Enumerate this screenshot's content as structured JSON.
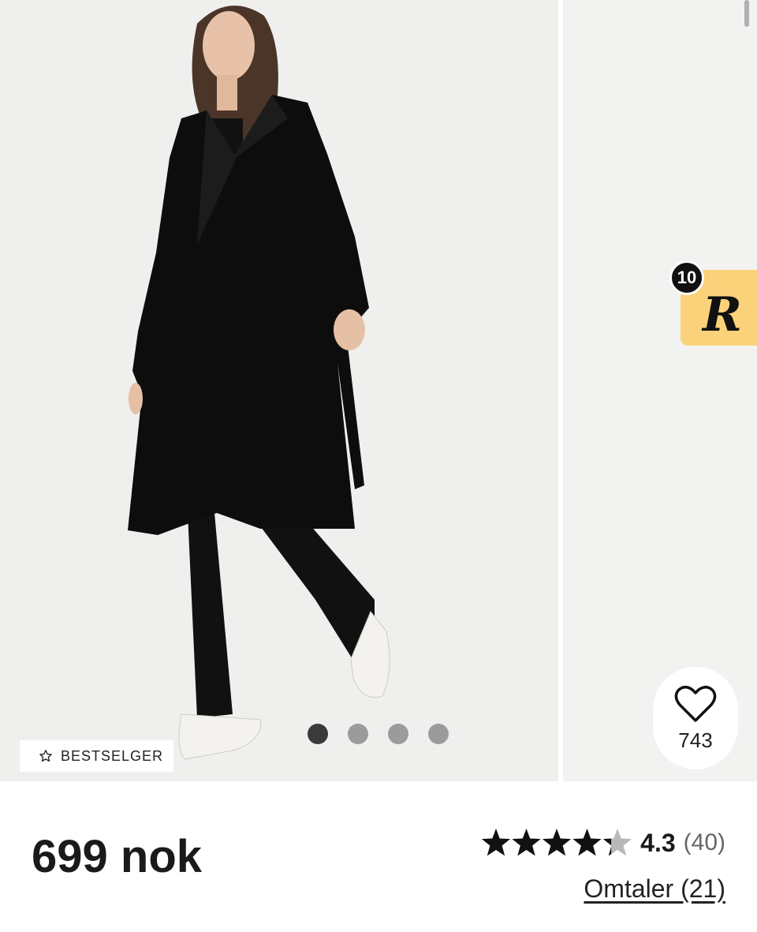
{
  "product": {
    "badge_label": "BESTSELGER",
    "price": "699 nok",
    "rating_value": "4.3",
    "rating_fraction": 0.86,
    "rating_count": "(40)",
    "reviews_link": "Omtaler (21)",
    "favorites_count": "743"
  },
  "gallery": {
    "image_count": 4,
    "active_index": 0,
    "promo_count": "10",
    "promo_letter": "R"
  },
  "icons": {
    "badge_icon": "star-outline-icon",
    "favorite_icon": "heart-outline-icon",
    "rating_icon": "star-icon"
  },
  "colors": {
    "background": "#efefee",
    "promo_yellow": "#fbd27a",
    "text_primary": "#1a1a1a",
    "dot_active": "#3a3a3a",
    "dot_inactive": "#9b9b9b"
  }
}
